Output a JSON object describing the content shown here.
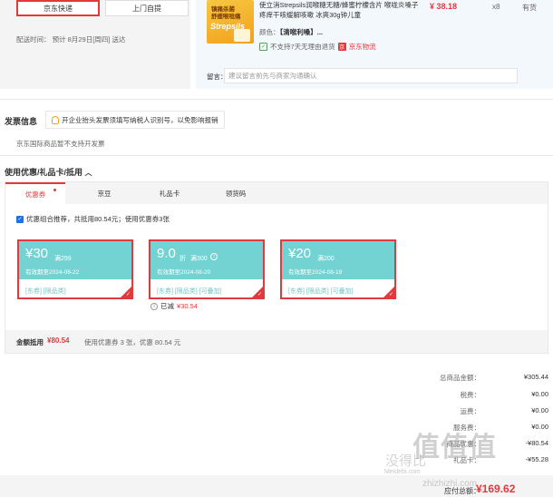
{
  "shipping": {
    "options": [
      "京东快递",
      "上门自提"
    ],
    "delivery_label": "配送时间：",
    "delivery_value": "预计 8月29日[周四] 送达"
  },
  "product": {
    "image_line1": "镇痛杀菌",
    "image_line2": "舒缓喉咙痛",
    "image_brand": "Strepsils",
    "title": "使立消Strepsils润喉糖无糖/蜂蜜柠檬含片 喉咙炎嗓子疼痒干咳缓解咳嗽 冰爽30g钟儿童",
    "price": "¥ 38.18",
    "qty": "x8",
    "stock": "有货",
    "color_label": "颜色：",
    "color_value": "【清喉利嗓】...",
    "no_return": "不支持7天无理由退货",
    "logistics": "京东物流",
    "logistics_icon_text": "京"
  },
  "memo": {
    "label": "留言：",
    "placeholder": "建议留言前先与商家沟通确认"
  },
  "invoice": {
    "title": "发票信息",
    "tip": "开企业抬头发票须填写纳税人识别号，以免影响报销",
    "note": "京东国际商品暂不支持开发票"
  },
  "coupons": {
    "title": "使用优惠/礼品卡/抵用",
    "chevron": "︿",
    "tabs": [
      "优惠券",
      "京豆",
      "礼品卡",
      "领货码"
    ],
    "combo_text": "优惠组合推荐，共抵用80.54元；使用优惠券3张",
    "items": [
      {
        "amount": "¥30",
        "cond": "满299",
        "expire": "有效期至2024-08-22",
        "tags": "[东券]  [限品类]"
      },
      {
        "amount": "9.0",
        "unit": "折",
        "cond": "满300",
        "expire": "有效期至2024-08-20",
        "tags": "[东券]  [限品类]  [可叠加]"
      },
      {
        "amount": "¥20",
        "cond": "满200",
        "expire": "有效期至2024-08-19",
        "tags": "[东券]  [限品类]  [可叠加]"
      }
    ],
    "reduced_label": "已减",
    "reduced_value": "¥30.54",
    "summary_label": "金额抵用",
    "summary_value": "¥80.54",
    "summary_used": "使用优惠券 3 张，优惠 80.54 元"
  },
  "totals": {
    "rows": [
      {
        "label": "总商品金额：",
        "value": "¥305.44"
      },
      {
        "label": "税费：",
        "value": "¥0.00"
      },
      {
        "label": "运费：",
        "value": "¥0.00"
      },
      {
        "label": "服务费：",
        "value": "¥0.00"
      },
      {
        "label": "商品优惠：",
        "value": "-¥80.54"
      },
      {
        "label": "礼品卡：",
        "value": "-¥55.28"
      }
    ],
    "pay_label": "应付总额：",
    "pay_value": "¥169.62"
  },
  "watermark": {
    "logo": "值值值",
    "cn": "没得比",
    "url": "Meidebi.com",
    "url2": "zhizhizhi.com"
  }
}
